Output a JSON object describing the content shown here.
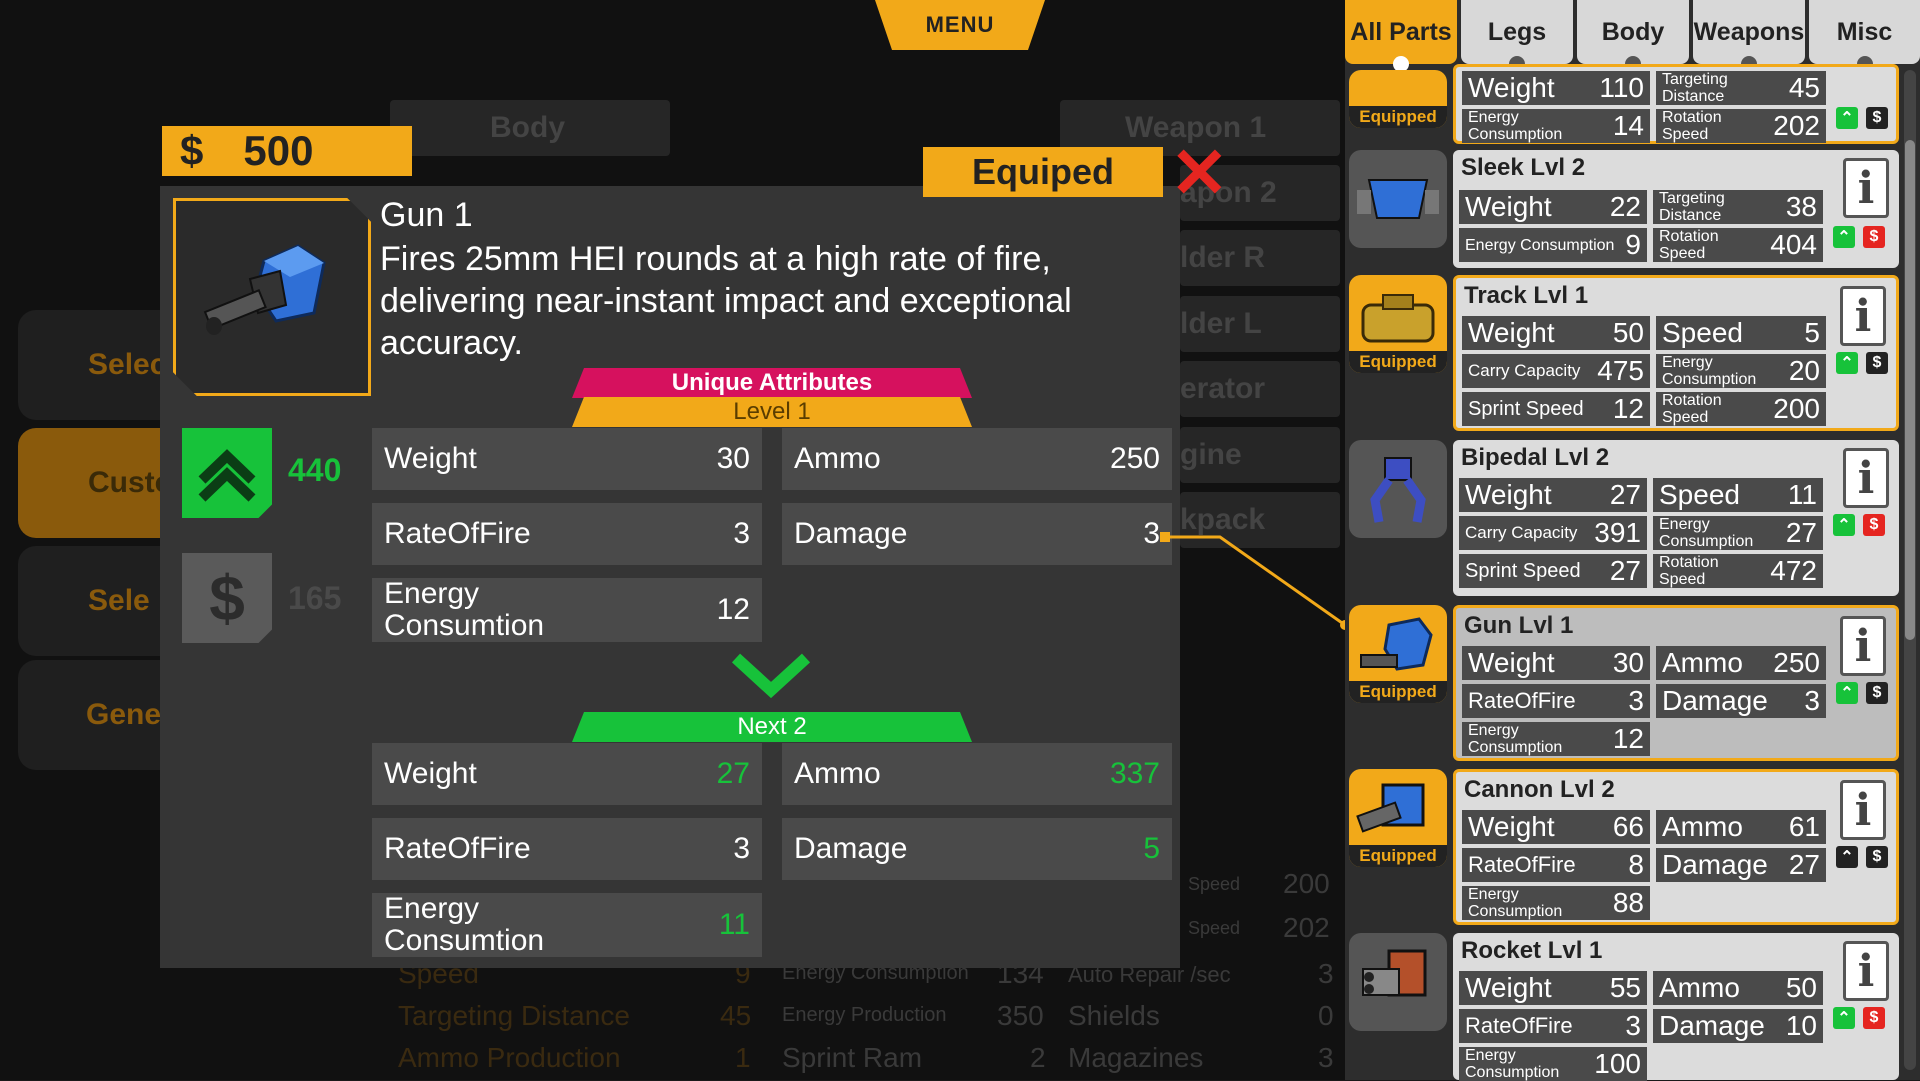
{
  "menu": {
    "label": "MENU"
  },
  "background": {
    "left_buttons": [
      "Selec",
      "Custor",
      "Sele",
      "Generator Part"
    ],
    "slots": [
      "Body",
      "Weapon 1",
      "apon 2",
      "lder R",
      "lder L",
      "erator",
      "gine",
      "kpack"
    ],
    "stats": [
      {
        "label": "Speed",
        "value": "9"
      },
      {
        "label": "Targeting Distance",
        "value": "45"
      },
      {
        "label": "Ammo Production",
        "value": "1"
      },
      {
        "label": "Energy Consumption",
        "value": "134"
      },
      {
        "label": "Energy Production",
        "value": "350"
      },
      {
        "label": "Sprint Ram",
        "value": "2"
      },
      {
        "label": "Auto Repair /sec",
        "value": "3"
      },
      {
        "label": "Shields",
        "value": "0"
      },
      {
        "label": "Magazines",
        "value": "3"
      },
      {
        "label": "Speed",
        "value": "200"
      },
      {
        "label": "Speed",
        "value": "202"
      }
    ]
  },
  "money": {
    "symbol": "$",
    "amount": "500"
  },
  "popup": {
    "equip_label": "Equiped",
    "close_symbol": "✕",
    "title": "Gun 1",
    "description": "Fires 25mm HEI rounds at a high rate of fire, delivering near-instant impact and exceptional accuracy.",
    "upgrade_cost": "440",
    "sell_value": "165",
    "sell_symbol": "$",
    "unique_label": "Unique Attributes",
    "level_label": "Level   1",
    "next_label": "Next   2",
    "current": [
      {
        "label": "Weight",
        "value": "30"
      },
      {
        "label": "Ammo",
        "value": "250"
      },
      {
        "label": "RateOfFire",
        "value": "3"
      },
      {
        "label": "Damage",
        "value": "3"
      },
      {
        "label": "Energy Consumtion",
        "value": "12"
      }
    ],
    "next": [
      {
        "label": "Weight",
        "value": "27"
      },
      {
        "label": "Ammo",
        "value": "337"
      },
      {
        "label": "RateOfFire",
        "value": "3"
      },
      {
        "label": "Damage",
        "value": "5"
      },
      {
        "label": "Energy Consumtion",
        "value": "11"
      }
    ]
  },
  "tabs": [
    "All Parts",
    "Legs",
    "Body",
    "Weapons",
    "Misc"
  ],
  "equipped_label": "Equipped",
  "info_symbol": "i",
  "cards": [
    {
      "name": "",
      "equipped": true,
      "cells": [
        [
          "Weight",
          "110"
        ],
        [
          "Targeting Distance",
          "45"
        ],
        [
          "Energy Consumption",
          "14"
        ],
        [
          "Rotation Speed",
          "202"
        ]
      ]
    },
    {
      "name": "Sleek  Lvl 2",
      "equipped": false,
      "cells": [
        [
          "Weight",
          "22"
        ],
        [
          "Targeting Distance",
          "38"
        ],
        [
          "Energy Consumption",
          "9"
        ],
        [
          "Rotation Speed",
          "404"
        ]
      ]
    },
    {
      "name": "Track  Lvl 1",
      "equipped": true,
      "cells": [
        [
          "Weight",
          "50"
        ],
        [
          "Speed",
          "5"
        ],
        [
          "Carry Capacity",
          "475"
        ],
        [
          "Energy Consumption",
          "20"
        ],
        [
          "Sprint Speed",
          "12"
        ],
        [
          "Rotation Speed",
          "200"
        ]
      ]
    },
    {
      "name": "Bipedal  Lvl 2",
      "equipped": false,
      "cells": [
        [
          "Weight",
          "27"
        ],
        [
          "Speed",
          "11"
        ],
        [
          "Carry Capacity",
          "391"
        ],
        [
          "Energy Consumption",
          "27"
        ],
        [
          "Sprint Speed",
          "27"
        ],
        [
          "Rotation Speed",
          "472"
        ]
      ]
    },
    {
      "name": "Gun Lvl 1",
      "equipped": true,
      "cells": [
        [
          "Weight",
          "30"
        ],
        [
          "Ammo",
          "250"
        ],
        [
          "RateOfFire",
          "3"
        ],
        [
          "Damage",
          "3"
        ],
        [
          "Energy Consumption",
          "12"
        ]
      ]
    },
    {
      "name": "Cannon Lvl 2",
      "equipped": true,
      "cells": [
        [
          "Weight",
          "66"
        ],
        [
          "Ammo",
          "61"
        ],
        [
          "RateOfFire",
          "8"
        ],
        [
          "Damage",
          "27"
        ],
        [
          "Energy Consumption",
          "88"
        ]
      ]
    },
    {
      "name": "Rocket Lvl 1",
      "equipped": false,
      "cells": [
        [
          "Weight",
          "55"
        ],
        [
          "Ammo",
          "50"
        ],
        [
          "RateOfFire",
          "3"
        ],
        [
          "Damage",
          "10"
        ],
        [
          "Energy Consumption",
          "100"
        ]
      ]
    }
  ],
  "colors": {
    "accent": "#f2a919",
    "green": "#17c23a",
    "red": "#e52520",
    "magenta": "#d6115e"
  }
}
